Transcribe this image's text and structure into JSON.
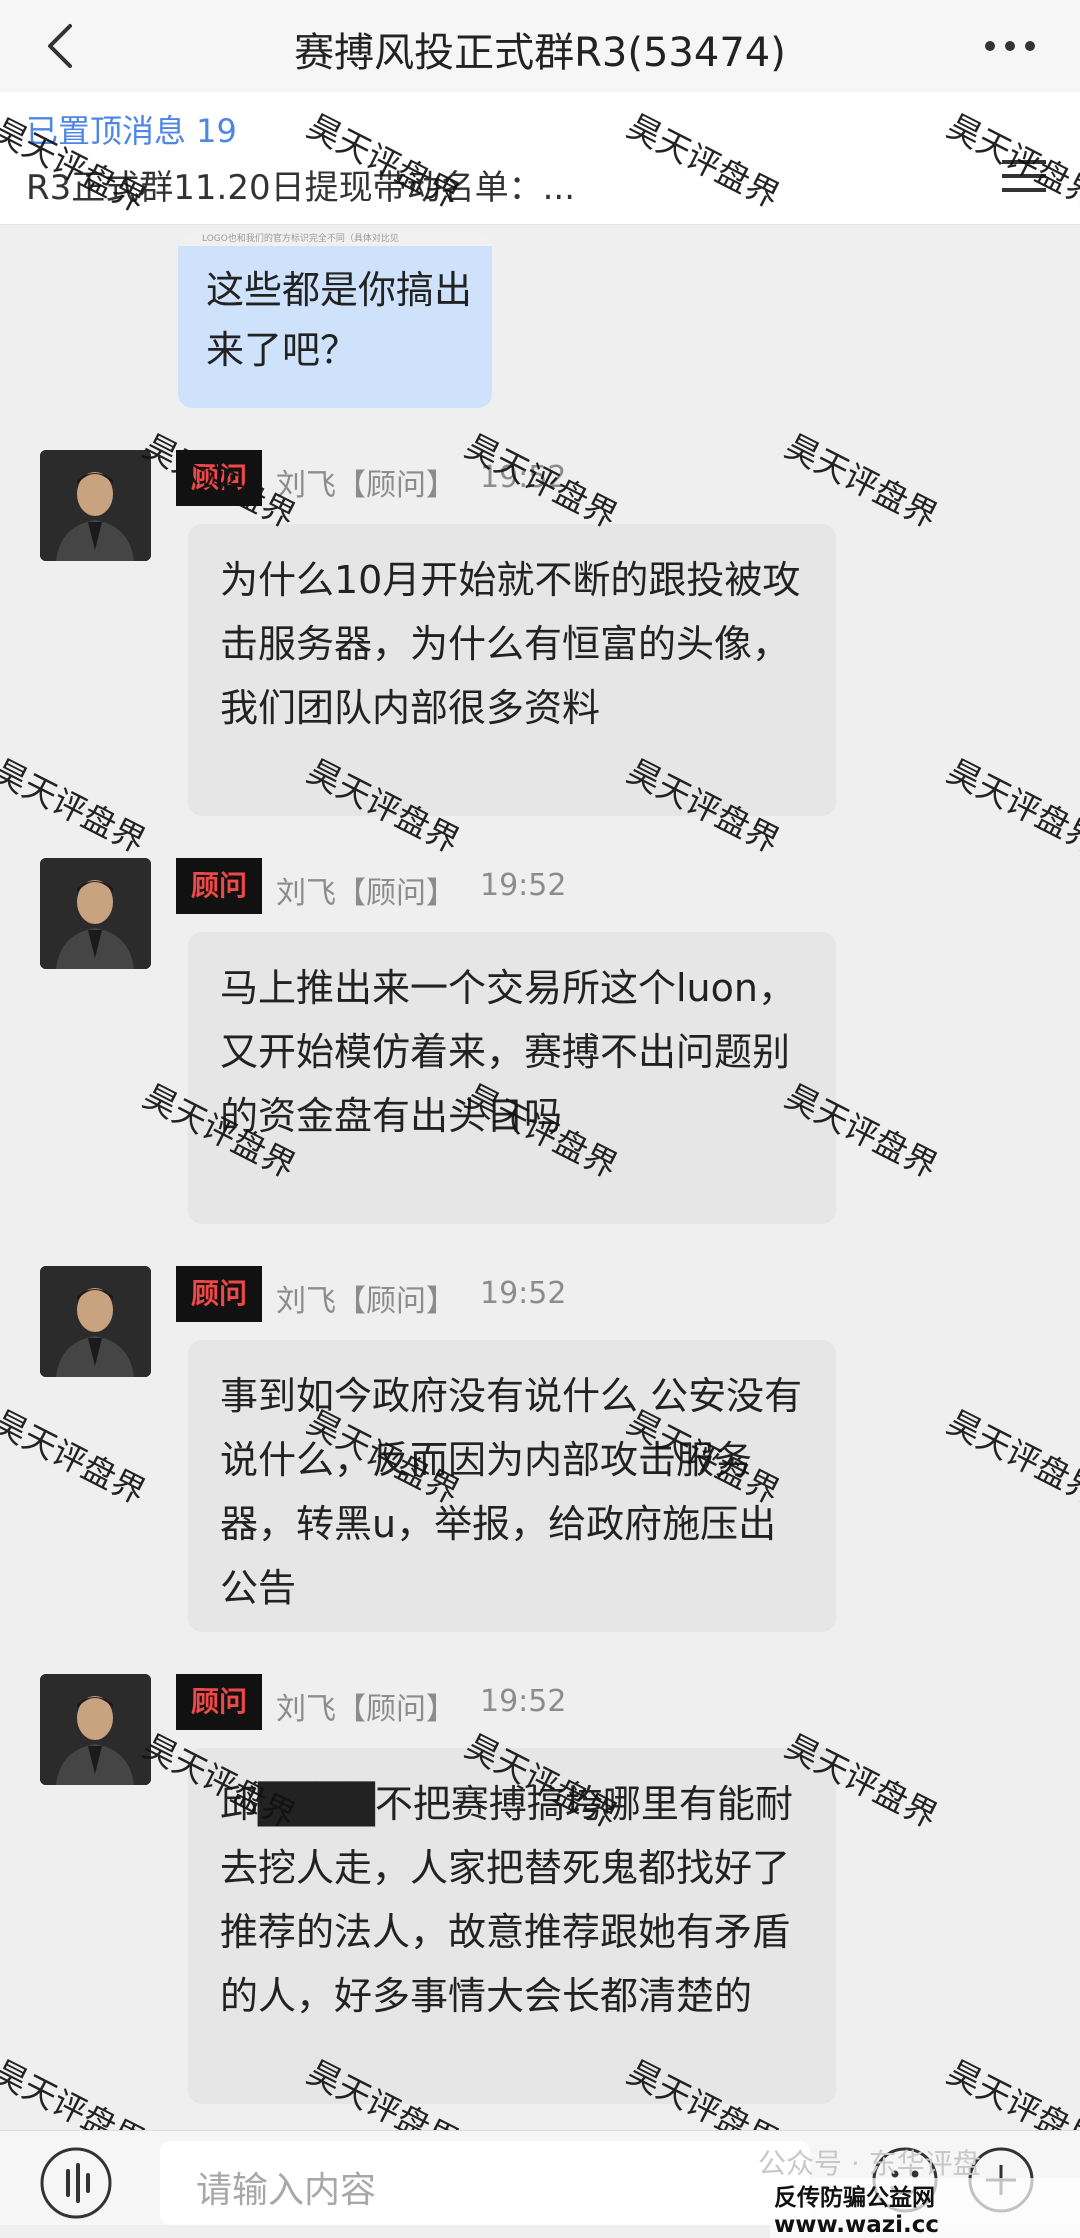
{
  "header": {
    "title": "赛搏风投正式群R3(53474)",
    "back_icon": "chevron-left-icon",
    "more_icon": "more-dots-icon"
  },
  "pinned": {
    "count_label": "已置顶消息 19",
    "text": "R3正式群11.20日提现带动名单：...",
    "list_icon": "list-icon"
  },
  "self_message": {
    "quoted_strip": "LOGO也和我们的官方标识完全不同（具体对比见",
    "text": "这些都是你搞出来了吧？"
  },
  "messages": [
    {
      "badge": "顾问",
      "sender": "刘飞【顾问】",
      "time": "19:52",
      "text": "为什么10月开始就不断的跟投被攻击服务器，为什么有恒富的头像，我们团队内部很多资料"
    },
    {
      "badge": "顾问",
      "sender": "刘飞【顾问】",
      "time": "19:52",
      "text": "马上推出来一个交易所这个luon，又开始模仿着来，赛搏不出问题别的资金盘有出头日吗"
    },
    {
      "badge": "顾问",
      "sender": "刘飞【顾问】",
      "time": "19:52",
      "text": "事到如今政府没有说什么 公安没有说什么，反而因为内部攻击服务器，转黑u，举报，给政府施压出公告"
    },
    {
      "badge": "顾问",
      "sender": "刘飞【顾问】",
      "time": "19:52",
      "text": "邱████不把赛搏搞垮哪里有能耐去挖人走，人家把替死鬼都找好了推荐的法人，故意推荐跟她有矛盾的人，好多事情大会长都清楚的"
    }
  ],
  "watermark": {
    "text": "昊天评盘界"
  },
  "input_bar": {
    "placeholder": "请输入内容",
    "voice_icon": "voice-icon",
    "emoji_icon": "emoji-icon",
    "plus_icon": "plus-icon"
  },
  "footer": {
    "wechat_mark": "公众号 · 东华评盘",
    "site": "反传防骗公益网 www.wazi.cc"
  },
  "colors": {
    "self_bubble": "#cfe2fb",
    "other_bubble": "#e6e6e6",
    "badge_bg": "#111111",
    "badge_text": "#f04848",
    "pinned_count": "#4d87e6"
  }
}
